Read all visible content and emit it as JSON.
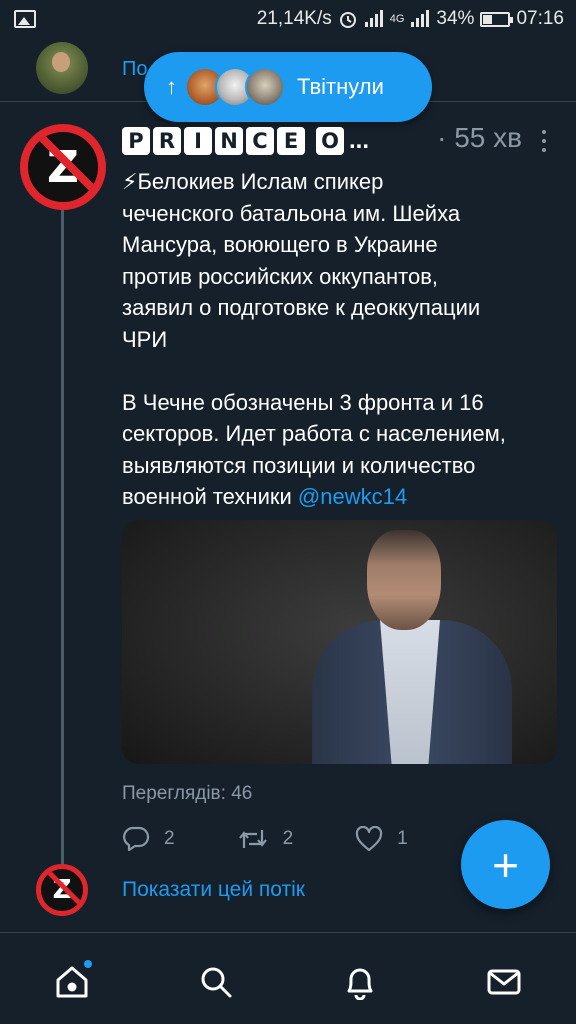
{
  "status_bar": {
    "speed": "21,14K/s",
    "network": "4G",
    "battery": "34%",
    "time": "07:16"
  },
  "prev_tweet": {
    "link_text": "По"
  },
  "retweet_pill": {
    "arrow": "↑",
    "label": "Твітнули"
  },
  "tweet": {
    "name_letters": [
      "P",
      "R",
      "I",
      "N",
      "C",
      "E",
      "O"
    ],
    "name_ellipsis": "...",
    "time": "· 55 хв",
    "text_main": "⚡Белокиев Ислам спикер\nчеченского батальона им. Шейха\nМансура, воюющего в Украине\nпротив российских оккупантов,\nзаявил о подготовке к деоккупации\nЧРИ\n\nВ Чечне обозначены 3 фронта и 16\nсекторов. Идет работа с населением,\nвыявляются позиции и количество\nвоенной техники ",
    "mention": "@newkc14",
    "avatar_letter": "Z",
    "views": "Переглядів: 46",
    "replies": "2",
    "retweets": "2",
    "likes": "1"
  },
  "thread": {
    "show_label": "Показати цей потік",
    "avatar_letter": "Z"
  },
  "fab": {
    "icon": "+"
  },
  "nav": {
    "items": [
      "home-icon",
      "search-icon",
      "notifications-icon",
      "messages-icon"
    ]
  },
  "colors": {
    "background": "#15202b",
    "accent": "#1d9bf0",
    "muted": "#8b98a5",
    "no_sign_red": "#e0262c"
  }
}
